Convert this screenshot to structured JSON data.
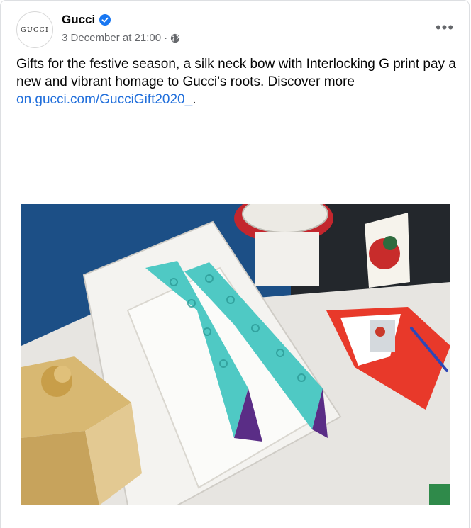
{
  "post": {
    "author": "Gucci",
    "avatar_text": "GUCCI",
    "verified": true,
    "timestamp": "3 December at 21:00",
    "separator": "·",
    "audience_icon": "globe-icon",
    "more_icon": "•••",
    "caption_text": "Gifts for the festive season, a silk neck bow with Interlocking G print pay a new and vibrant homage to Gucci’s roots. Discover more",
    "link_text": "on.gucci.com/GucciGift2020_",
    "caption_end": "."
  },
  "colors": {
    "link": "#216fdb",
    "verified_badge": "#1877f2",
    "meta_text": "#65676b",
    "scarf_teal": "#4fc9c4",
    "envelope_red": "#e8392a",
    "gift_gold": "#d8b872",
    "wall_blue": "#1c4f86"
  }
}
